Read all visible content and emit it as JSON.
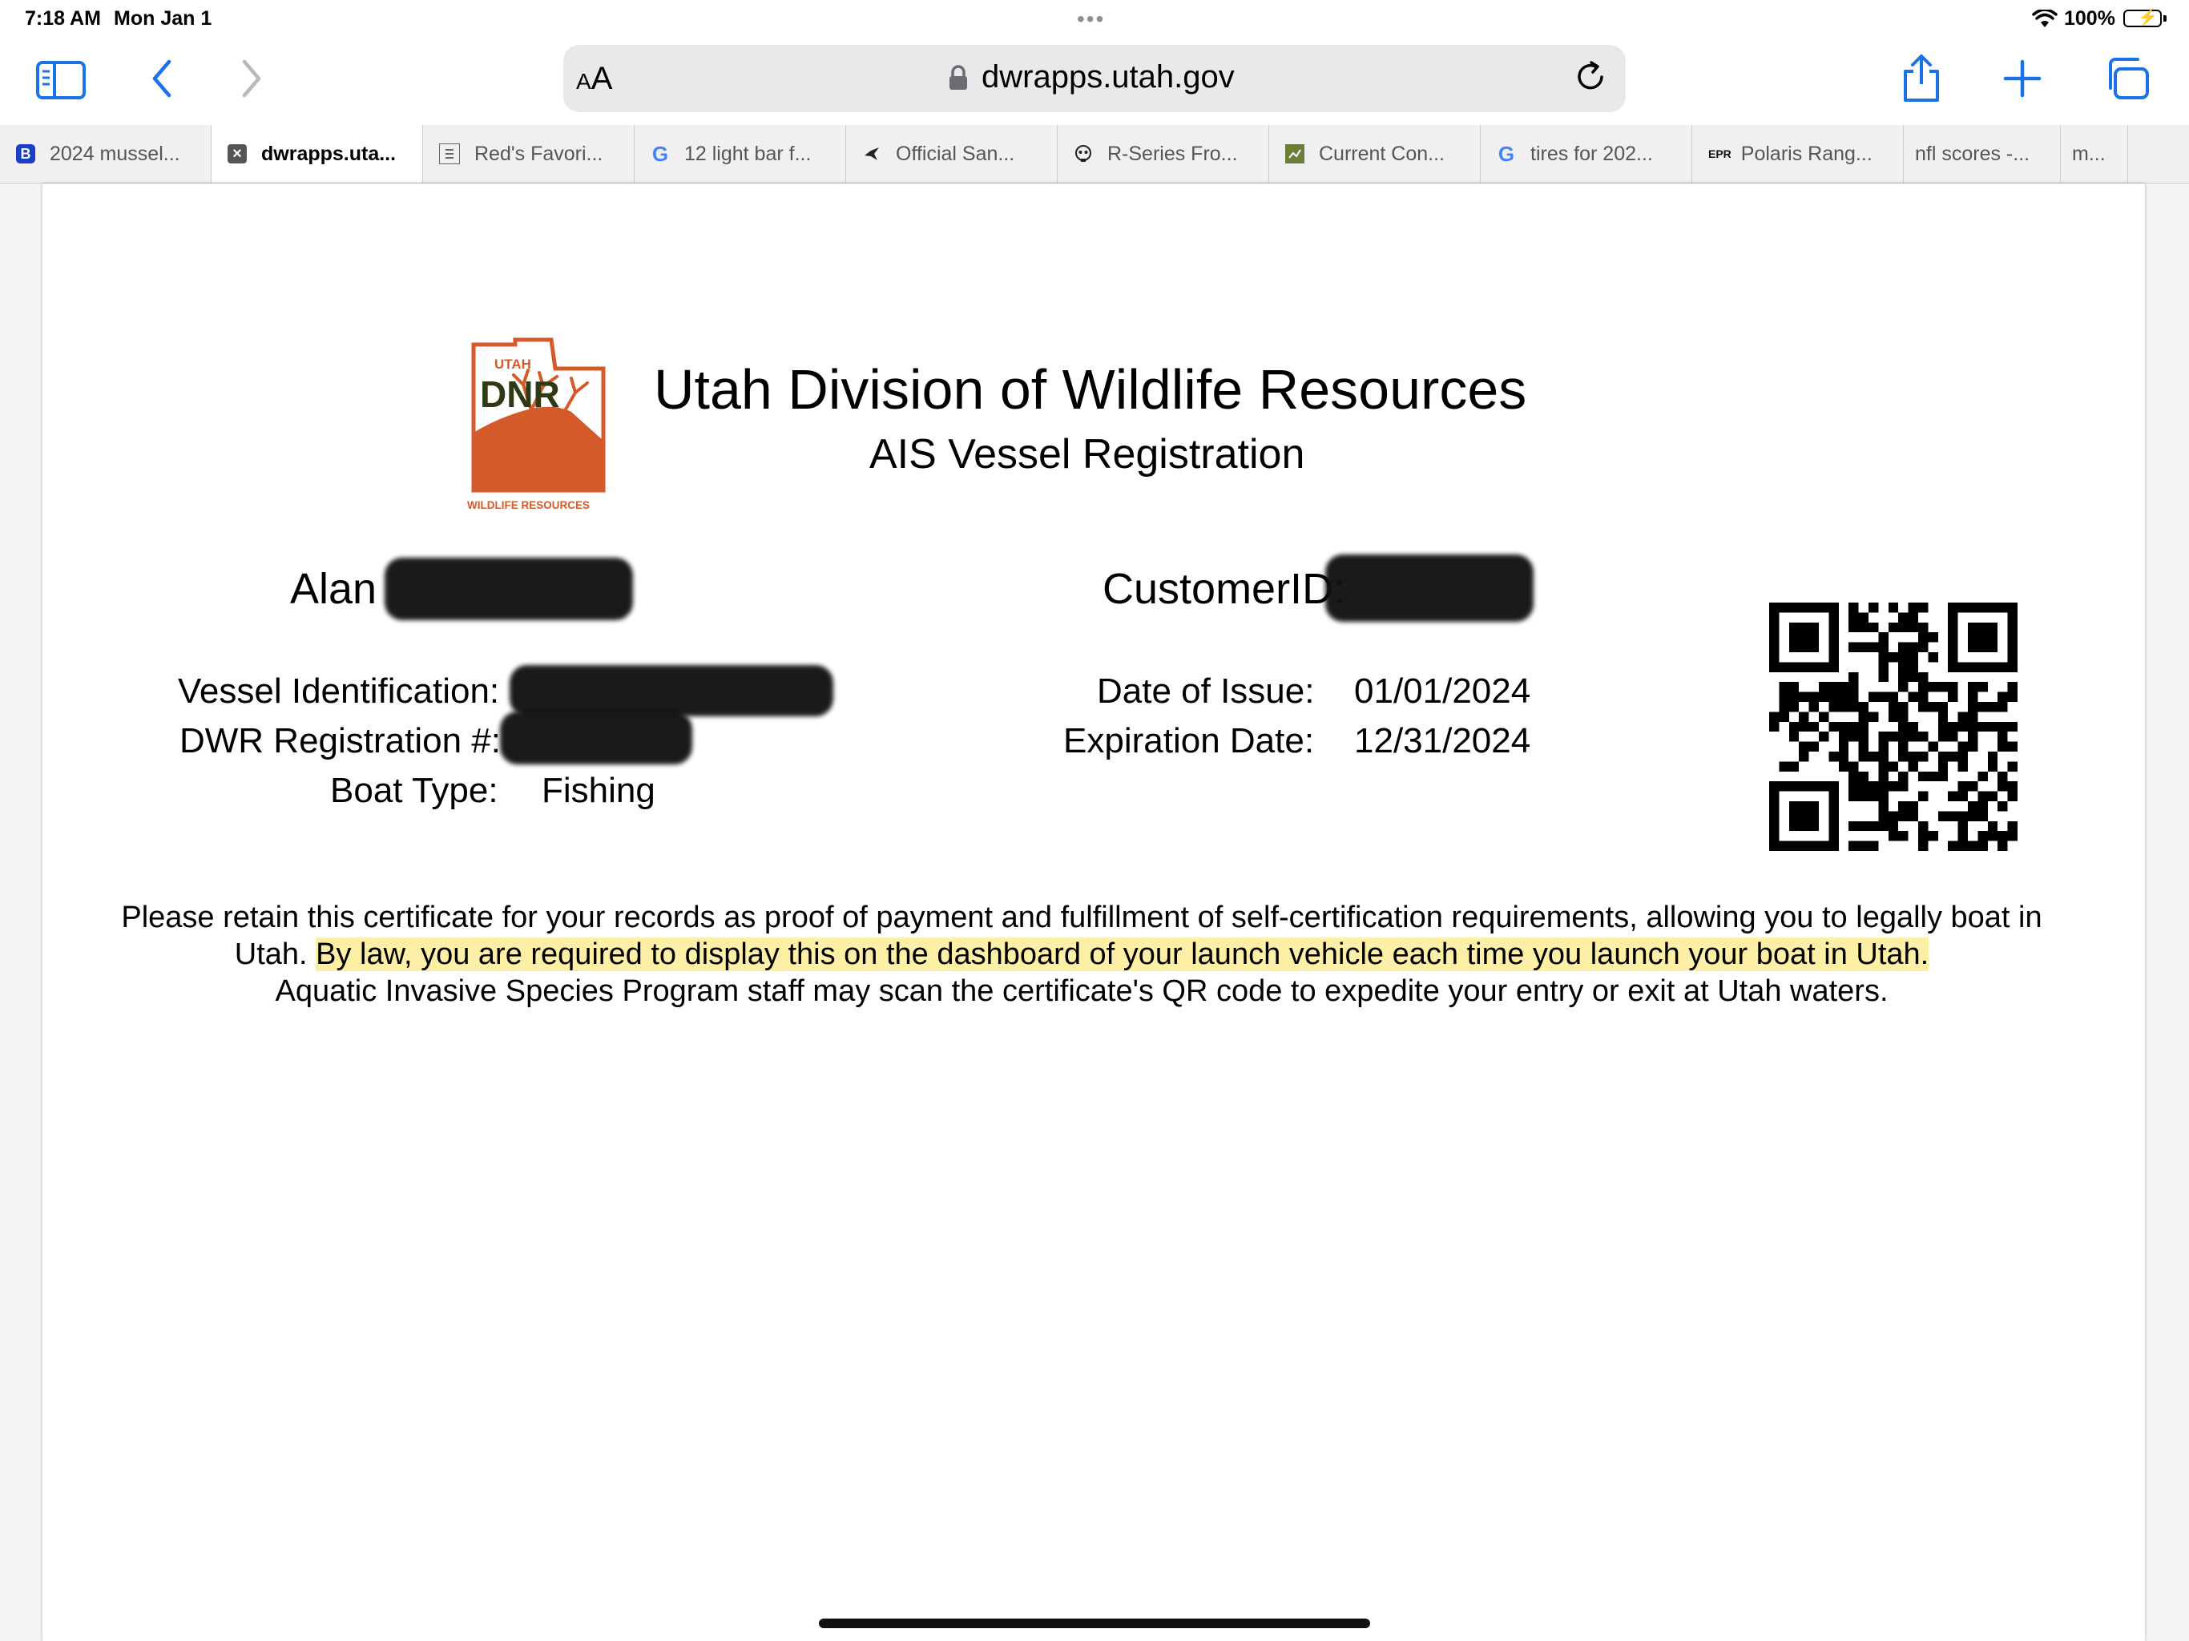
{
  "status_bar": {
    "time": "7:18 AM",
    "date": "Mon Jan 1",
    "dots": "•••",
    "battery": "100%"
  },
  "toolbar": {
    "aa_label_small": "A",
    "aa_label": "A",
    "url": "dwrapps.utah.gov"
  },
  "tabs": [
    {
      "label": "2024 mussel...",
      "favicon": "B",
      "active": false
    },
    {
      "label": "dwrapps.uta...",
      "favicon": "×",
      "active": true
    },
    {
      "label": "Red's Favori...",
      "favicon": "doc-icon",
      "active": false
    },
    {
      "label": "12 light bar f...",
      "favicon": "G",
      "active": false
    },
    {
      "label": "Official San...",
      "favicon": "bird-icon",
      "active": false
    },
    {
      "label": "R-Series Fro...",
      "favicon": "skull-icon",
      "active": false
    },
    {
      "label": "Current Con...",
      "favicon": "map-icon",
      "active": false
    },
    {
      "label": "tires for 202...",
      "favicon": "G",
      "active": false
    },
    {
      "label": "Polaris Rang...",
      "favicon": "EPR",
      "active": false
    },
    {
      "label": "nfl scores -...",
      "favicon": "",
      "active": false
    },
    {
      "label": "m...",
      "favicon": "",
      "active": false
    }
  ],
  "certificate": {
    "logo": {
      "top_text": "UTAH",
      "main_text": "DNR",
      "bottom_text": "WILDLIFE RESOURCES",
      "color": "#d45a2a"
    },
    "title": "Utah Division of Wildlife Resources",
    "subtitle": "AIS Vessel Registration",
    "owner_name": "Alan",
    "customer_id_label": "CustomerID:",
    "vessel_id_label": "Vessel Identification:",
    "registration_label": "DWR Registration #:",
    "boat_type_label": "Boat Type:",
    "boat_type_value": "Fishing",
    "date_of_issue_label": "Date of Issue:",
    "date_of_issue_value": "01/01/2024",
    "expiration_label": "Expiration Date:",
    "expiration_value": "12/31/2024",
    "notice_part1": "Please retain this certificate for your records as proof of payment and fulfillment of self-certification requirements, allowing you to legally boat in Utah. ",
    "notice_highlight": "By law, you are required to display this on the dashboard of your launch vehicle each time you launch your boat in Utah.",
    "notice_part2": "Aquatic Invasive Species Program staff may scan the certificate's QR code to expedite your entry or exit at Utah waters.",
    "highlight_color": "#fdf0a6"
  }
}
